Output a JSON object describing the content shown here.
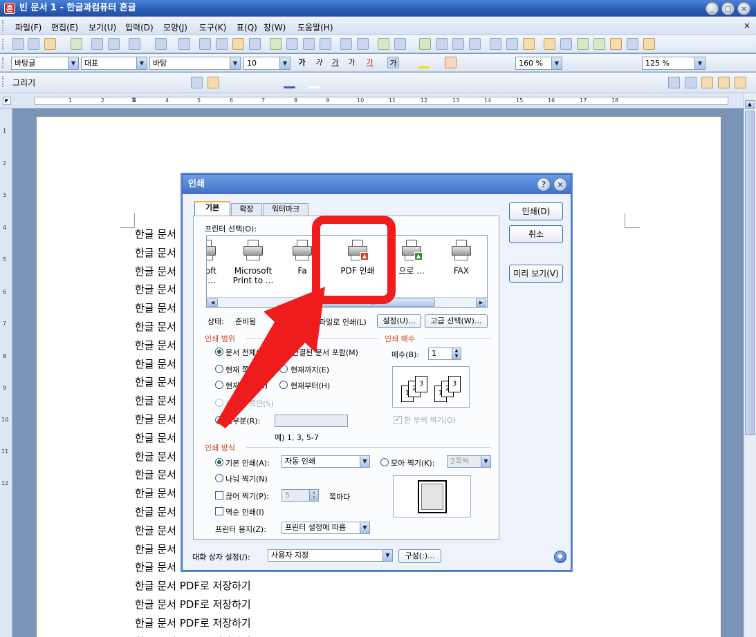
{
  "window": {
    "title": "빈 문서 1 - 한글과컴퓨터 흔글",
    "app_icon_glyph": "흔",
    "controls": [
      "_",
      "□",
      "×"
    ]
  },
  "menubar": {
    "items": [
      "파일(F)",
      "편집(E)",
      "보기(U)",
      "입력(D)",
      "모양(J)",
      "도구(K)",
      "표(Q)",
      "창(W)",
      "도움말(H)"
    ],
    "close_glyph": "×"
  },
  "format_toolbar": {
    "style": "바탕글",
    "language": "대표",
    "font": "바탕",
    "font_size": "10",
    "line_spacing": "160 %",
    "zoom": "125 %",
    "char_buttons": [
      "가",
      "가",
      "가",
      "가",
      "가",
      "가"
    ]
  },
  "draw_toolbar": {
    "label": "그리기"
  },
  "ruler": {
    "ticks": [
      "1",
      "2",
      "3",
      "4",
      "5",
      "6",
      "7",
      "8",
      "9",
      "10",
      "11",
      "12",
      "13",
      "14",
      "15",
      "16",
      "17",
      "18"
    ],
    "vticks": [
      "1",
      "2",
      "3",
      "4",
      "5",
      "6",
      "7",
      "8",
      "9",
      "10",
      "11",
      "12"
    ]
  },
  "document": {
    "lines": [
      "한글 문서 PDF로 저장하기",
      "한글 문서 PDF로 저장하기",
      "한글 문서 PDF로 저장하기",
      "한글 문서 PDF로 저장하기",
      "한글 문서 PDF로 저장하기",
      "한글 문서 PDF로 저장하기",
      "한글 문서 PDF로 저장하기",
      "한글 문서 PDF로 저장하기",
      "한글 문서 PDF로 저장하기",
      "한글 문서 PDF로 저장하기",
      "한글 문서 PDF로 저장하기",
      "한글 문서 PDF로 저장하기",
      "한글 문서 PDF로 저장하기",
      "한글 문서 PDF로 저장하기",
      "한글 문서 PDF로 저장하기",
      "한글 문서 PDF로 저장하기",
      "한글 문서 PDF로 저장하기",
      "한글 문서 PDF로 저장하기",
      "한글 문서 PDF로 저장하기",
      "한글 문서 PDF로 저장하기",
      "한글 문서 PDF로 저장하기",
      "한글 문서 PDF로 저장하기",
      "한글 문서 PDF로 저장하기",
      "한글 문서 PDF로 저장하기"
    ]
  },
  "print_dialog": {
    "title": "인쇄",
    "tabs": [
      "기본",
      "확장",
      "워터마크"
    ],
    "printer_select_label": "프린터 선택(O):",
    "printers": [
      {
        "name": "osoft\nto ..."
      },
      {
        "name": "Microsoft\nPrint to ..."
      },
      {
        "name": "Fa"
      },
      {
        "name": "PDF 인쇄"
      },
      {
        "name": "으로 ..."
      },
      {
        "name": "FAX"
      }
    ],
    "status_label": "상태:",
    "status_value": "준비됨",
    "print_to_file": "파일로 인쇄(L)",
    "settings_button": "설정(U)...",
    "advanced_button": "고급 선택(W)...",
    "range": {
      "title": "인쇄 범위",
      "all_doc": "문서 전체(T)",
      "include_linked": "연결된 문서 포함(M)",
      "current_page": "현재 쪽(A)",
      "up_to_current": "현재까지(E)",
      "current_section": "현재 구역(G)",
      "from_current": "현재부터(H)",
      "selected_pages": "선택한 쪽만(S)",
      "partial": "일부분(R):",
      "example": "예) 1, 3, 5-7"
    },
    "copies": {
      "title": "인쇄 매수",
      "label": "매수(B):",
      "value": "1",
      "collate": "한 부씩 찍기(O)",
      "sheet_labels": [
        "1",
        "2",
        "3",
        "1",
        "2",
        "3"
      ]
    },
    "method": {
      "title": "인쇄 방식",
      "basic": "기본 인쇄(A):",
      "basic_value": "자동 인쇄",
      "nup": "모아 찍기(K):",
      "nup_value": "2쪽씩",
      "split": "나눠 찍기(N)",
      "cut": "끊어 찍기(P):",
      "cut_value": "5",
      "per_page": "쪽마다",
      "reverse": "역순 인쇄(I)",
      "paper_label": "프린터 용지(Z):",
      "paper_value": "프린터 설정에 따름"
    },
    "dialog_setting_label": "대화 상자 설정(/):",
    "dialog_setting_value": "사용자 지정",
    "config_button": "구성(:)...",
    "print_button": "인쇄(D)",
    "cancel_button": "취소",
    "preview_button": "미리 보기(V)"
  },
  "annotation": {
    "color": "#ee1c1c"
  }
}
